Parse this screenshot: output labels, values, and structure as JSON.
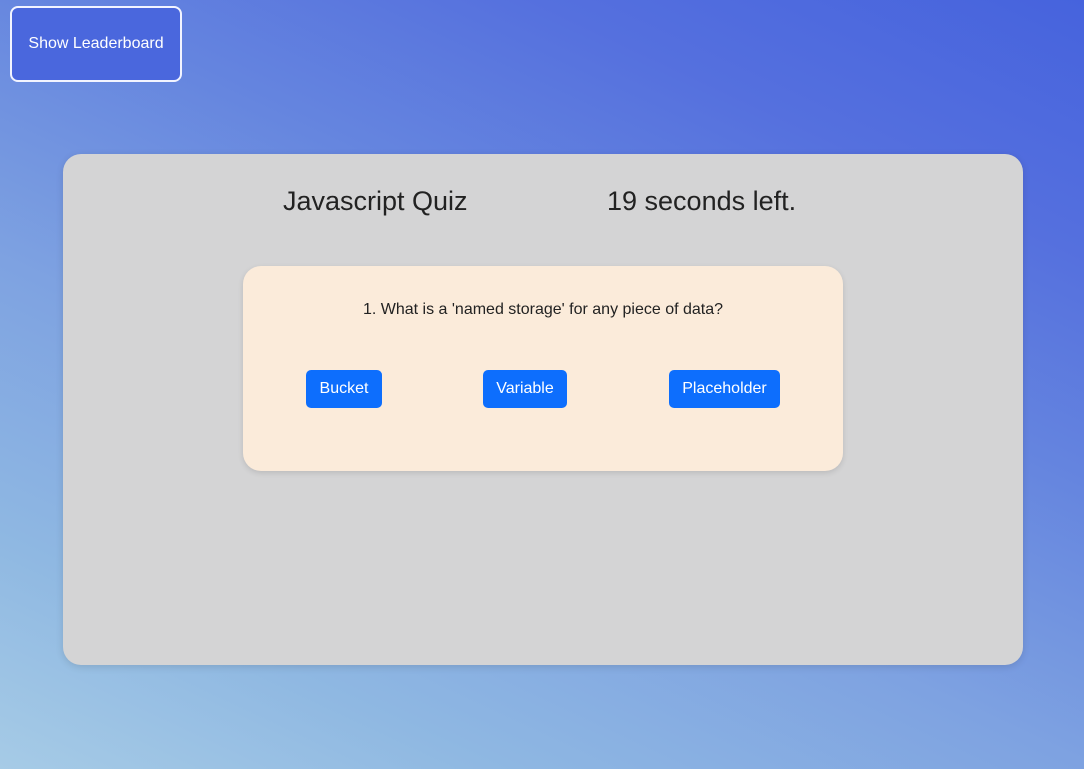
{
  "header": {
    "leaderboard_label": "Show Leaderboard"
  },
  "quiz": {
    "title": "Javascript Quiz",
    "timer_text": "19 seconds left.",
    "question": {
      "text": "1. What is a 'named storage' for any piece of data?",
      "answers": [
        {
          "label": "Bucket"
        },
        {
          "label": "Variable"
        },
        {
          "label": "Placeholder"
        }
      ]
    }
  },
  "colors": {
    "answer_button": "#0d6efd",
    "leaderboard_button": "#4a67dd",
    "panel": "#d4d4d5",
    "question_card": "#fbebda"
  }
}
